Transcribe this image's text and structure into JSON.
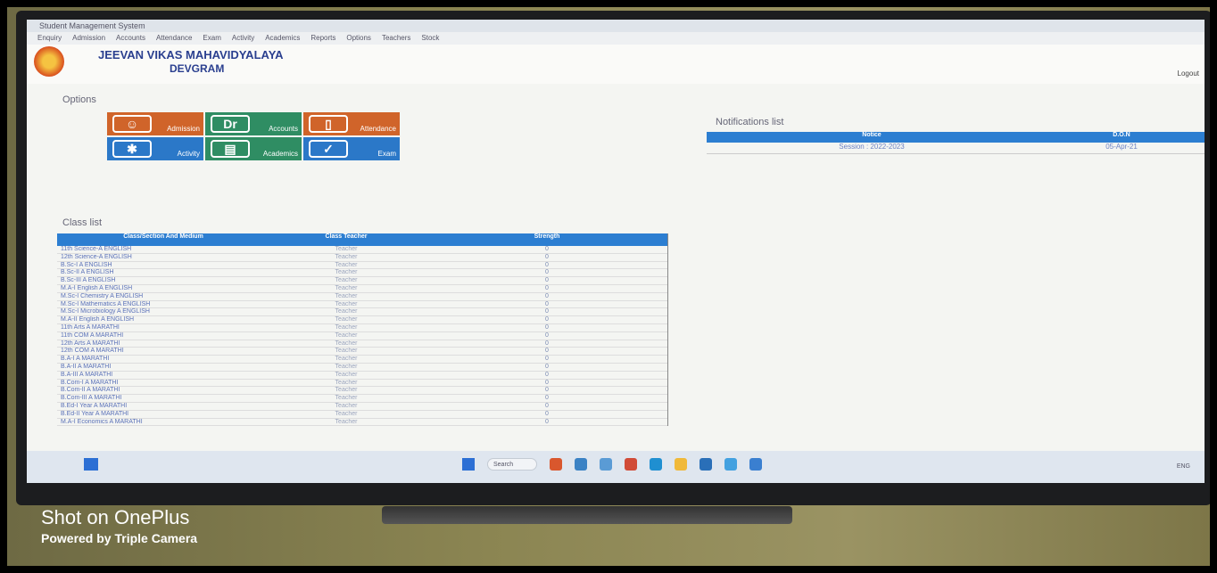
{
  "app": {
    "window_title": "Student Management System"
  },
  "menu": {
    "items": [
      "Enquiry",
      "Admission",
      "Accounts",
      "Attendance",
      "Exam",
      "Activity",
      "Academics",
      "Reports",
      "Options",
      "Teachers",
      "Stock"
    ]
  },
  "header": {
    "school_name": "JEEVAN VIKAS MAHAVIDYALAYA",
    "school_place": "DEVGRAM",
    "logout": "Logout"
  },
  "options": {
    "title": "Options",
    "tiles": [
      {
        "label": "Admission",
        "icon_text": "",
        "icon": "person-icon"
      },
      {
        "label": "Accounts",
        "icon_text": "Dr",
        "icon": "ledger-icon"
      },
      {
        "label": "Attendance",
        "icon_text": "",
        "icon": "clipboard-icon"
      },
      {
        "label": "Activity",
        "icon_text": "",
        "icon": "puzzle-icon"
      },
      {
        "label": "Academics",
        "icon_text": "",
        "icon": "certificate-icon"
      },
      {
        "label": "Exam",
        "icon_text": "",
        "icon": "exam-icon"
      }
    ]
  },
  "notifications": {
    "title": "Notifications list",
    "headers": [
      "Notice",
      "D.O.N"
    ],
    "rows": [
      {
        "notice": "Session : 2022-2023",
        "don": "05-Apr-21"
      }
    ]
  },
  "class_list": {
    "title": "Class list",
    "headers": [
      "Class/Section And Medium",
      "Class Teacher",
      "Strength"
    ],
    "rows": [
      {
        "class": "11th Science-A ENGLISH",
        "teacher": "Teacher",
        "strength": "0"
      },
      {
        "class": "12th Science-A ENGLISH",
        "teacher": "Teacher",
        "strength": "0"
      },
      {
        "class": "B.Sc-I A ENGLISH",
        "teacher": "Teacher",
        "strength": "0"
      },
      {
        "class": "B.Sc-II A ENGLISH",
        "teacher": "Teacher",
        "strength": "0"
      },
      {
        "class": "B.Sc-III A ENGLISH",
        "teacher": "Teacher",
        "strength": "0"
      },
      {
        "class": "M.A-I English A ENGLISH",
        "teacher": "Teacher",
        "strength": "0"
      },
      {
        "class": "M.Sc-I Chemistry A ENGLISH",
        "teacher": "Teacher",
        "strength": "0"
      },
      {
        "class": "M.Sc-I Mathematics A ENGLISH",
        "teacher": "Teacher",
        "strength": "0"
      },
      {
        "class": "M.Sc-I Microbiology A ENGLISH",
        "teacher": "Teacher",
        "strength": "0"
      },
      {
        "class": "M.A-II English A ENGLISH",
        "teacher": "Teacher",
        "strength": "0"
      },
      {
        "class": "11th Arts A MARATHI",
        "teacher": "Teacher",
        "strength": "0"
      },
      {
        "class": "11th COM A MARATHI",
        "teacher": "Teacher",
        "strength": "0"
      },
      {
        "class": "12th Arts A MARATHI",
        "teacher": "Teacher",
        "strength": "0"
      },
      {
        "class": "12th COM A MARATHI",
        "teacher": "Teacher",
        "strength": "0"
      },
      {
        "class": "B.A-I A MARATHI",
        "teacher": "Teacher",
        "strength": "0"
      },
      {
        "class": "B.A-II A MARATHI",
        "teacher": "Teacher",
        "strength": "0"
      },
      {
        "class": "B.A-III A MARATHI",
        "teacher": "Teacher",
        "strength": "0"
      },
      {
        "class": "B.Com-I A MARATHI",
        "teacher": "Teacher",
        "strength": "0"
      },
      {
        "class": "B.Com-II A MARATHI",
        "teacher": "Teacher",
        "strength": "0"
      },
      {
        "class": "B.Com-III A MARATHI",
        "teacher": "Teacher",
        "strength": "0"
      },
      {
        "class": "B.Ed-I Year A MARATHI",
        "teacher": "Teacher",
        "strength": "0"
      },
      {
        "class": "B.Ed-II Year A MARATHI",
        "teacher": "Teacher",
        "strength": "0"
      },
      {
        "class": "M.A-I Economics A MARATHI",
        "teacher": "Teacher",
        "strength": "0"
      }
    ]
  },
  "taskbar": {
    "search_label": "Search",
    "tray_text": "ENG"
  },
  "watermark": {
    "line1": "Shot on OnePlus",
    "line2": "Powered by Triple Camera"
  },
  "colors": {
    "tile_orange": "#d0642a",
    "tile_green": "#2f8d63",
    "tile_blue": "#2b78c8",
    "header_blue": "#2c7ed1",
    "school_name": "#2a3f8f"
  }
}
